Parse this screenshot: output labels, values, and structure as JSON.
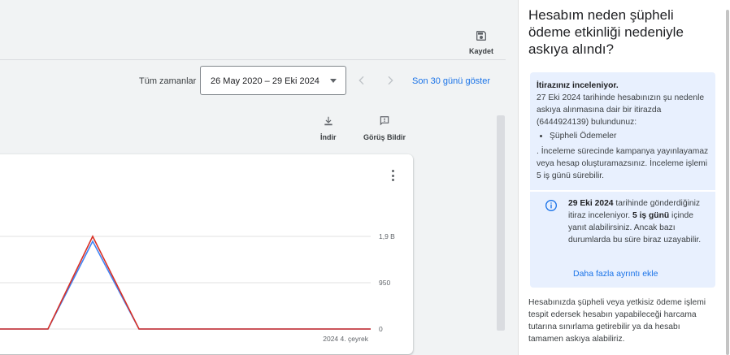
{
  "toolbar": {
    "save_label": "Kaydet"
  },
  "date_range": {
    "label": "Tüm zamanlar",
    "value": "26 May 2020 – 29 Eki 2024",
    "last30_label": "Son 30 günü göster"
  },
  "report_tools": {
    "download_label": "İndir",
    "feedback_label": "Görüş Bildir"
  },
  "chart_data": {
    "type": "line",
    "x_tick_labels": [
      "2024 4. çeyrek"
    ],
    "y_tick_labels": [
      "1,9 B",
      "950",
      "0"
    ],
    "ylim": [
      0,
      1900
    ],
    "grid": true,
    "series": [
      {
        "color": "#d93025",
        "values": [
          0,
          0,
          1900,
          0,
          0
        ]
      },
      {
        "color": "#4285f4",
        "values": [
          0,
          0,
          1800,
          0,
          0
        ]
      }
    ]
  },
  "panel": {
    "title": "Hesabım neden şüpheli ödeme etkinliği nedeniyle askıya alındı?",
    "review_heading": "İtirazınız inceleniyor.",
    "review_body": "27 Eki 2024 tarihinde hesabınızın şu nedenle askıya alınmasına dair bir itirazda (6444924139) bulundunuz:",
    "reason_item": "Şüpheli Ödemeler",
    "review_note": ". İnceleme sürecinde kampanya yayınlayamaz veya hesap oluşturamazsınız. İnceleme işlemi 5 iş günü sürebilir.",
    "status_date": "29 Eki 2024",
    "status_text_1": " tarihinde gönderdiğiniz itiraz inceleniyor. ",
    "status_days": "5 iş günü",
    "status_text_2": " içinde yanıt alabilirsiniz. Ancak bazı durumlarda bu süre biraz uzayabilir.",
    "more_link": "Daha fazla ayrıntı ekle",
    "footer": "Hesabınızda şüpheli veya yetkisiz ödeme işlemi tespit edersek hesabın yapabileceği harcama tutarına sınırlama getirebilir ya da hesabı tamamen askıya alabiliriz."
  }
}
